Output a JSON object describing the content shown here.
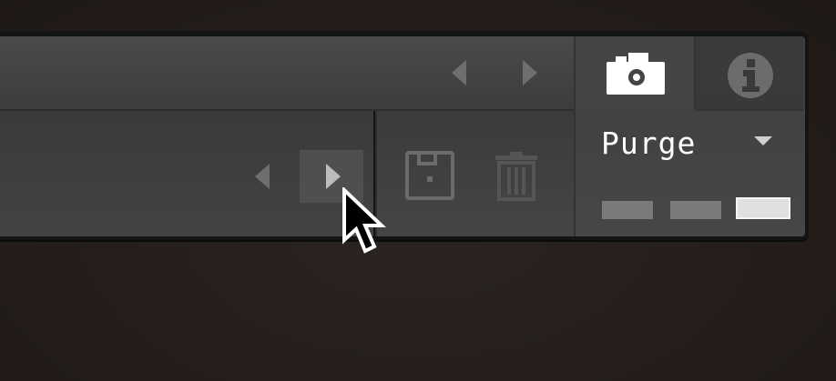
{
  "toolbar": {
    "top_prev_icon": "triangle-left-icon",
    "top_next_icon": "triangle-right-icon",
    "bottom_prev_icon": "triangle-left-icon",
    "bottom_next_icon": "triangle-right-icon",
    "save_icon": "save-preset-icon",
    "delete_icon": "trash-icon"
  },
  "right_panel": {
    "snapshot_icon": "camera-icon",
    "info_icon": "info-icon",
    "purge_label": "Purge",
    "purge_dropdown_icon": "chevron-down-icon",
    "purge_levels": [
      {
        "state": "inactive"
      },
      {
        "state": "inactive"
      },
      {
        "state": "active"
      }
    ]
  },
  "cursor": "arrow-cursor-icon",
  "colors": {
    "background": "#261f1b",
    "panel": "#444444",
    "icon_dim": "#6e6e6e",
    "text": "#ffffff"
  }
}
